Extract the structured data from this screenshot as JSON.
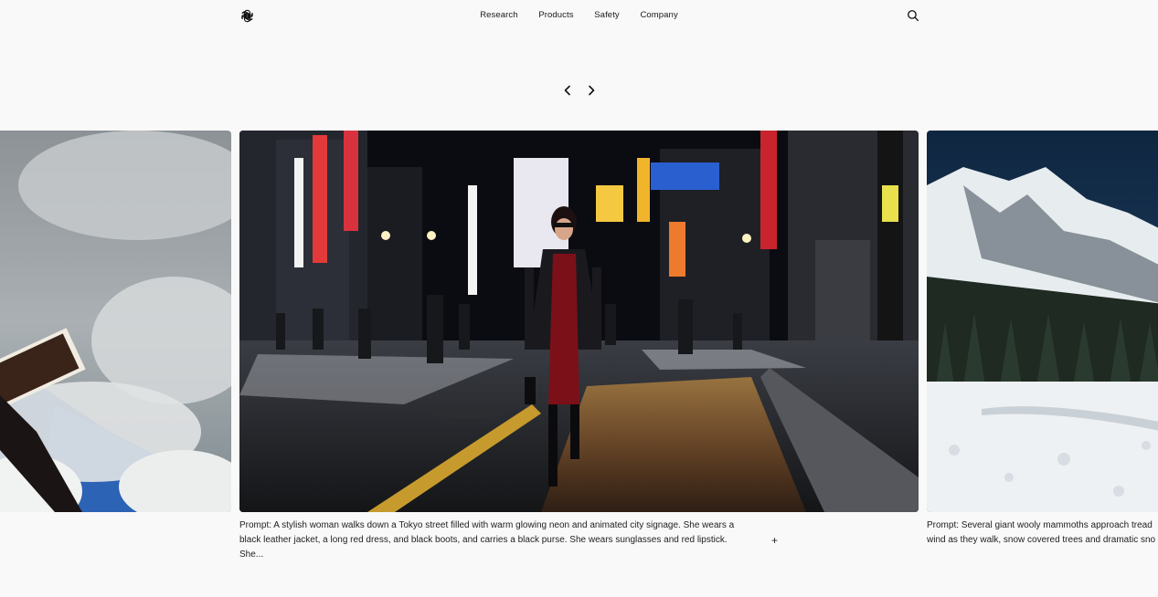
{
  "header": {
    "nav": [
      "Research",
      "Products",
      "Safety",
      "Company"
    ]
  },
  "icons": {
    "logo": "openai-logo-icon",
    "search": "search-icon",
    "prev": "chevron-left-icon",
    "next": "chevron-right-icon",
    "expand": "plus-icon"
  },
  "slides": {
    "center": {
      "caption_line1": "Prompt: A stylish woman walks down a Tokyo street filled with warm glowing neon and animated city signage. She wears a",
      "caption_line2": "black leather jacket, a long red dress, and black boots, and carries a black purse. She wears sunglasses and red lipstick. She..."
    },
    "right": {
      "caption_line1": "Prompt: Several giant wooly mammoths approach tread",
      "caption_line2": "wind as they walk, snow covered trees and dramatic sno"
    }
  },
  "expand_label": "+"
}
